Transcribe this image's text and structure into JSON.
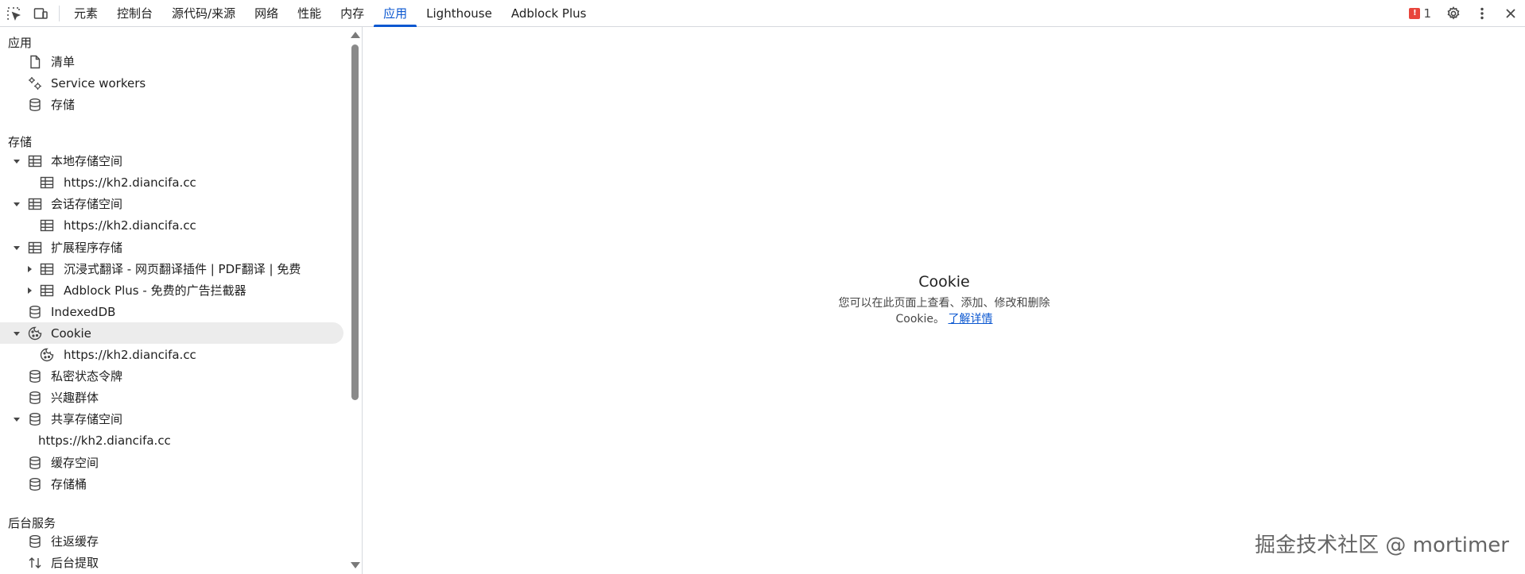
{
  "toolbar": {
    "tabs": [
      {
        "label": "元素"
      },
      {
        "label": "控制台"
      },
      {
        "label": "源代码/来源"
      },
      {
        "label": "网络"
      },
      {
        "label": "性能"
      },
      {
        "label": "内存"
      },
      {
        "label": "应用"
      },
      {
        "label": "Lighthouse"
      },
      {
        "label": "Adblock Plus"
      }
    ],
    "active_tab": "应用",
    "issues_count": "1"
  },
  "sidebar": {
    "sections": {
      "app": "应用",
      "storage": "存储",
      "background": "后台服务"
    },
    "items": {
      "manifest": "清单",
      "service_workers": "Service workers",
      "storage": "存储",
      "local_storage": "本地存储空间",
      "local_storage_origin": "https://kh2.diancifa.cc",
      "session_storage": "会话存储空间",
      "session_storage_origin": "https://kh2.diancifa.cc",
      "extension_storage": "扩展程序存储",
      "ext_immersive": "沉浸式翻译 - 网页翻译插件 | PDF翻译 | 免费",
      "ext_adblock": "Adblock Plus - 免费的广告拦截器",
      "indexeddb": "IndexedDB",
      "cookie": "Cookie",
      "cookie_origin": "https://kh2.diancifa.cc",
      "private_state_tokens": "私密状态令牌",
      "interest_groups": "兴趣群体",
      "shared_storage": "共享存储空间",
      "shared_storage_origin": "https://kh2.diancifa.cc",
      "cache_storage": "缓存空间",
      "storage_buckets": "存储桶",
      "bfcache": "往返缓存",
      "background_fetch": "后台提取"
    }
  },
  "main": {
    "title": "Cookie",
    "description": "您可以在此页面上查看、添加、修改和删除 Cookie。",
    "link": "了解详情"
  },
  "watermark": "掘金技术社区 @ mortimer",
  "colors": {
    "accent": "#0b57d0",
    "selected_bg": "#ececec"
  }
}
